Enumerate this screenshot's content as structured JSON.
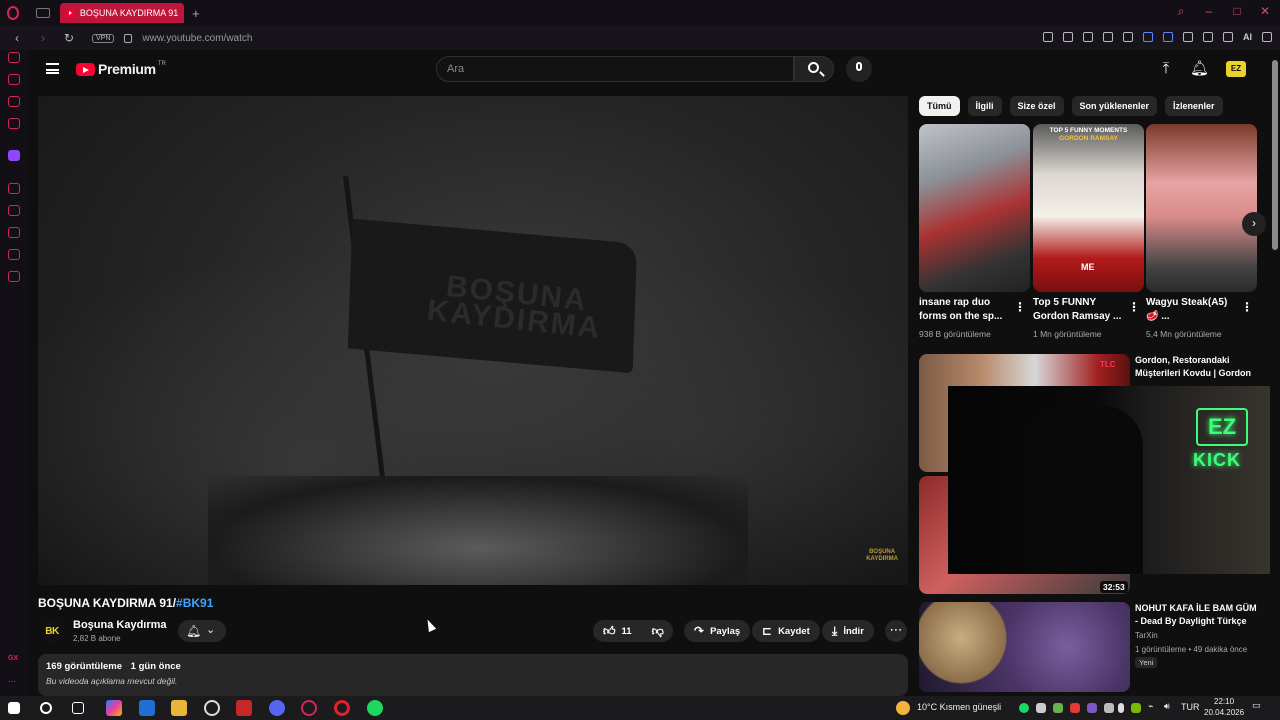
{
  "browser": {
    "tab_title": "BOŞUNA KAYDIRMA 91/#B",
    "new_tab": "+",
    "vpn_label": "VPN",
    "url": "www.youtube.com/watch",
    "ai_label": "AI",
    "sidebar_gx": "GX",
    "sidebar_more": "..."
  },
  "youtube": {
    "logo_text": "Premium",
    "logo_region": "TR",
    "search_placeholder": "Ara",
    "ez_badge": "EZ"
  },
  "video": {
    "title_main": "BOŞUNA KAYDIRMA 91/",
    "title_tag": "#BK91",
    "flag_text_line1": "BOŞUNA",
    "flag_text_line2": "KAYDIRMA",
    "watermark_line1": "BOŞUNA",
    "watermark_line2": "KAYDIRMA",
    "channel_avatar_text": "BK",
    "channel_name": "Boşuna Kaydırma",
    "subscribers": "2,82 B abone",
    "like_count": "11",
    "share_label": "Paylaş",
    "save_label": "Kaydet",
    "download_label": "İndir",
    "views": "169 görüntüleme",
    "uploaded": "1 gün önce",
    "description": "Bu videoda açıklama mevcut değil."
  },
  "chips": [
    "Tümü",
    "İlgili",
    "Size özel",
    "Son yüklenenler",
    "İzlenenler"
  ],
  "shorts": [
    {
      "title": "insane rap duo forms on the sp...",
      "views": "938 B görüntüleme"
    },
    {
      "title": "Top 5 FUNNY Gordon Ramsay ...",
      "views": "1 Mn görüntüleme",
      "overlay_top": "TOP 5 FUNNY MOMENTS",
      "overlay_name": "GORDON RAMSAY",
      "overlay_me": "ME"
    },
    {
      "title": "Wagyu Steak(A5) 🥩 ...",
      "views": "5,4 Mn görüntüleme"
    }
  ],
  "recommended": [
    {
      "title": "Gordon, Restorandaki Müşterileri Kovdu | Gordon ...",
      "channel": "TLC"
    },
    {
      "duration": "32:53"
    },
    {
      "title": "NOHUT KAFA İLE BAM GÜM - Dead By Daylight Türkçe",
      "channel": "TarXin",
      "meta": "1 görüntüleme • 49 dakika önce",
      "badge": "Yeni"
    }
  ],
  "overlay": {
    "ez": "EZ",
    "kick": "KICK"
  },
  "taskbar": {
    "weather": "10°C  Kısmen güneşli",
    "lang": "TUR",
    "time": "22:10",
    "date": "20.04.2026"
  }
}
